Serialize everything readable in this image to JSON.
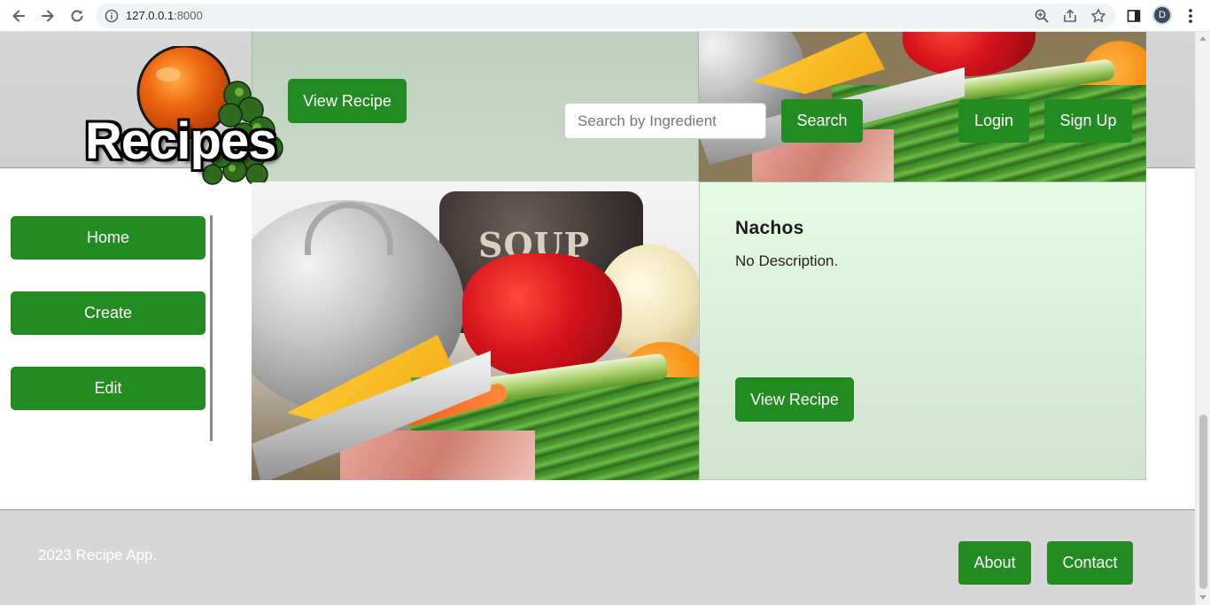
{
  "browser": {
    "url_host": "127.0.0.1",
    "url_port": ":8000",
    "profile_initial": "D",
    "icons": [
      "back-icon",
      "forward-icon",
      "reload-icon",
      "site-info-icon",
      "zoom-icon",
      "share-icon",
      "star-icon",
      "side-panel-icon",
      "menu-dots-icon"
    ]
  },
  "header": {
    "logo_text": "Recipes",
    "search": {
      "placeholder": "Search by Ingredient",
      "value": "",
      "button_label": "Search"
    },
    "auth": {
      "login_label": "Login",
      "signup_label": "Sign Up"
    }
  },
  "sidebar": {
    "items": [
      {
        "label": "Home"
      },
      {
        "label": "Create"
      },
      {
        "label": "Edit"
      }
    ]
  },
  "recipes": [
    {
      "view_label": "View Recipe"
    },
    {
      "title": "Nachos",
      "description": "No Description.",
      "view_label": "View Recipe",
      "image_text": "SOUP"
    }
  ],
  "footer": {
    "copyright": "2023 Recipe App.",
    "about_label": "About",
    "contact_label": "Contact"
  },
  "colors": {
    "accent": "#228b22",
    "card_bg": "#dff3dc",
    "header_bg": "#d3d3d3"
  }
}
